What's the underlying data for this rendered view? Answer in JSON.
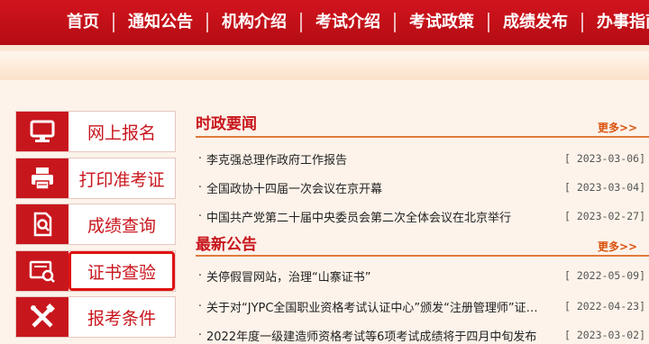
{
  "nav": {
    "items": [
      "首页",
      "通知公告",
      "机构介绍",
      "考试介绍",
      "考试政策",
      "成绩发布",
      "办事指南"
    ]
  },
  "side_menu": {
    "items": [
      {
        "label": "网上报名",
        "icon": "monitor-icon"
      },
      {
        "label": "打印准考证",
        "icon": "printer-icon"
      },
      {
        "label": "成绩查询",
        "icon": "document-search-icon"
      },
      {
        "label": "证书查验",
        "icon": "certificate-verify-icon",
        "active": true
      },
      {
        "label": "报考条件",
        "icon": "tools-icon"
      }
    ]
  },
  "sections": {
    "news": {
      "title": "时政要闻",
      "more": "更多>>",
      "items": [
        {
          "title": "李克强总理作政府工作报告",
          "date": "[ 2023-03-06]"
        },
        {
          "title": "全国政协十四届一次会议在京开幕",
          "date": "[ 2023-03-04]"
        },
        {
          "title": "中国共产党第二十届中央委员会第二次全体会议在北京举行",
          "date": "[ 2023-02-27]"
        }
      ]
    },
    "notices": {
      "title": "最新公告",
      "more": "更多>>",
      "items": [
        {
          "title": "关停假冒网站，治理“山寨证书”",
          "date": "[ 2022-05-09]"
        },
        {
          "title": "关于对“JYPC全国职业资格考试认证中心”颁发“注册管理师”证书的说明",
          "date": "[ 2022-04-23]"
        },
        {
          "title": "2022年度一级建造师资格考试等6项考试成绩将于四月中旬发布",
          "date": "[ 2023-03-02]"
        }
      ]
    }
  },
  "colors": {
    "brand_red": "#c8161d",
    "accent_orange": "#d9530d"
  }
}
